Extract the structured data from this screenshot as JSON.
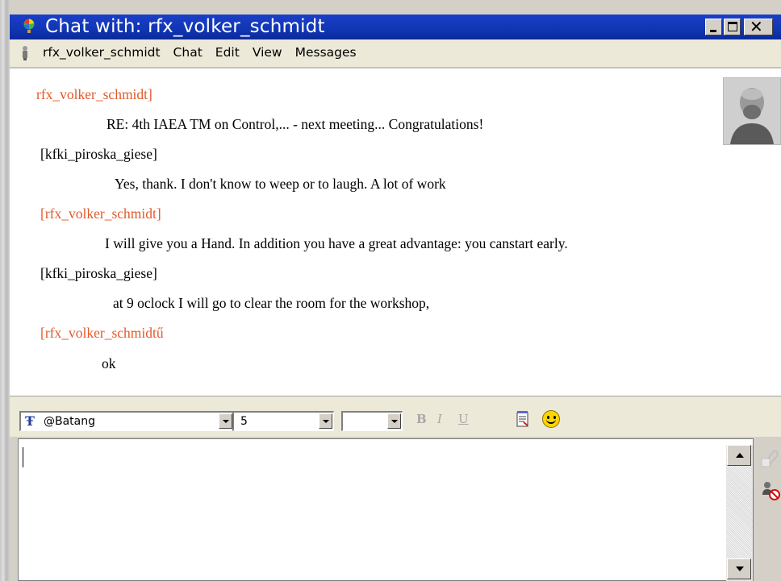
{
  "window": {
    "title": "Chat with: rfx_volker_schmidt",
    "title_bar_color": "#1036b4"
  },
  "menu": {
    "items": [
      "rfx_volker_schmidt",
      "Chat",
      "Edit",
      "View",
      "Messages"
    ]
  },
  "chat": {
    "sender_color": "#e25a2a",
    "messages": [
      {
        "sender": "rfx_volker_schmidt]",
        "text": "RE: 4th IAEA TM on Control,... - next meeting... Congratulations!"
      },
      {
        "sender": "[kfki_piroska_giese]",
        "text": "Yes, thank. I don't know to weep or to laugh. A lot of work"
      },
      {
        "sender": "[rfx_volker_schmidt]",
        "text": "I will give you a Hand. In addition you have a great advantage: you canstart early."
      },
      {
        "sender": "[kfki_piroska_giese]",
        "text": "at 9 oclock I will go to clear the room for the workshop,"
      },
      {
        "sender": "[rfx_volker_schmidtű",
        "text": "ok"
      }
    ]
  },
  "format_toolbar": {
    "font": "@Batang",
    "size": "5",
    "color": "",
    "bold_label": "B",
    "italic_label": "I",
    "underline_label": "U"
  },
  "input": {
    "value": ""
  }
}
